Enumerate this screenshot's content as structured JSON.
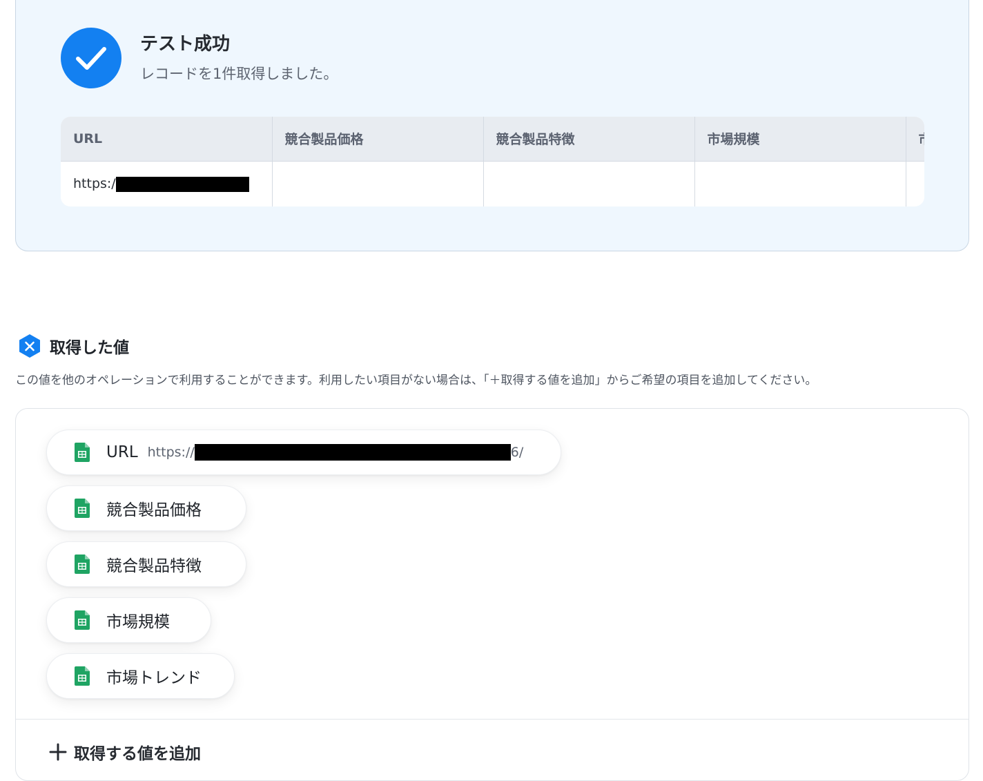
{
  "success": {
    "title": "テスト成功",
    "subtitle": "レコードを1件取得しました。",
    "table": {
      "headers": [
        "URL",
        "競合製品価格",
        "競合製品特徴",
        "市場規模",
        "市"
      ],
      "row": {
        "url_prefix": "https:/",
        "competitor_price": "",
        "competitor_features": "",
        "market_size": "",
        "market_trend": ""
      }
    }
  },
  "obtained": {
    "title": "取得した値",
    "description": "この値を他のオペレーションで利用することができます。利用したい項目がない場合は、「＋取得する値を追加」からご希望の項目を追加してください。",
    "items": [
      {
        "label": "URL",
        "value_prefix": "https://",
        "value_suffix": "6/"
      },
      {
        "label": "競合製品価格"
      },
      {
        "label": "競合製品特徴"
      },
      {
        "label": "市場規模"
      },
      {
        "label": "市場トレンド"
      }
    ],
    "add_label": "取得する値を追加"
  },
  "colors": {
    "accent": "#1380f1",
    "sheets_green": "#1fa463"
  },
  "icons": {
    "success": "check-circle-icon",
    "variable": "variable-x-icon",
    "sheet": "google-sheets-icon",
    "add": "plus-icon"
  }
}
